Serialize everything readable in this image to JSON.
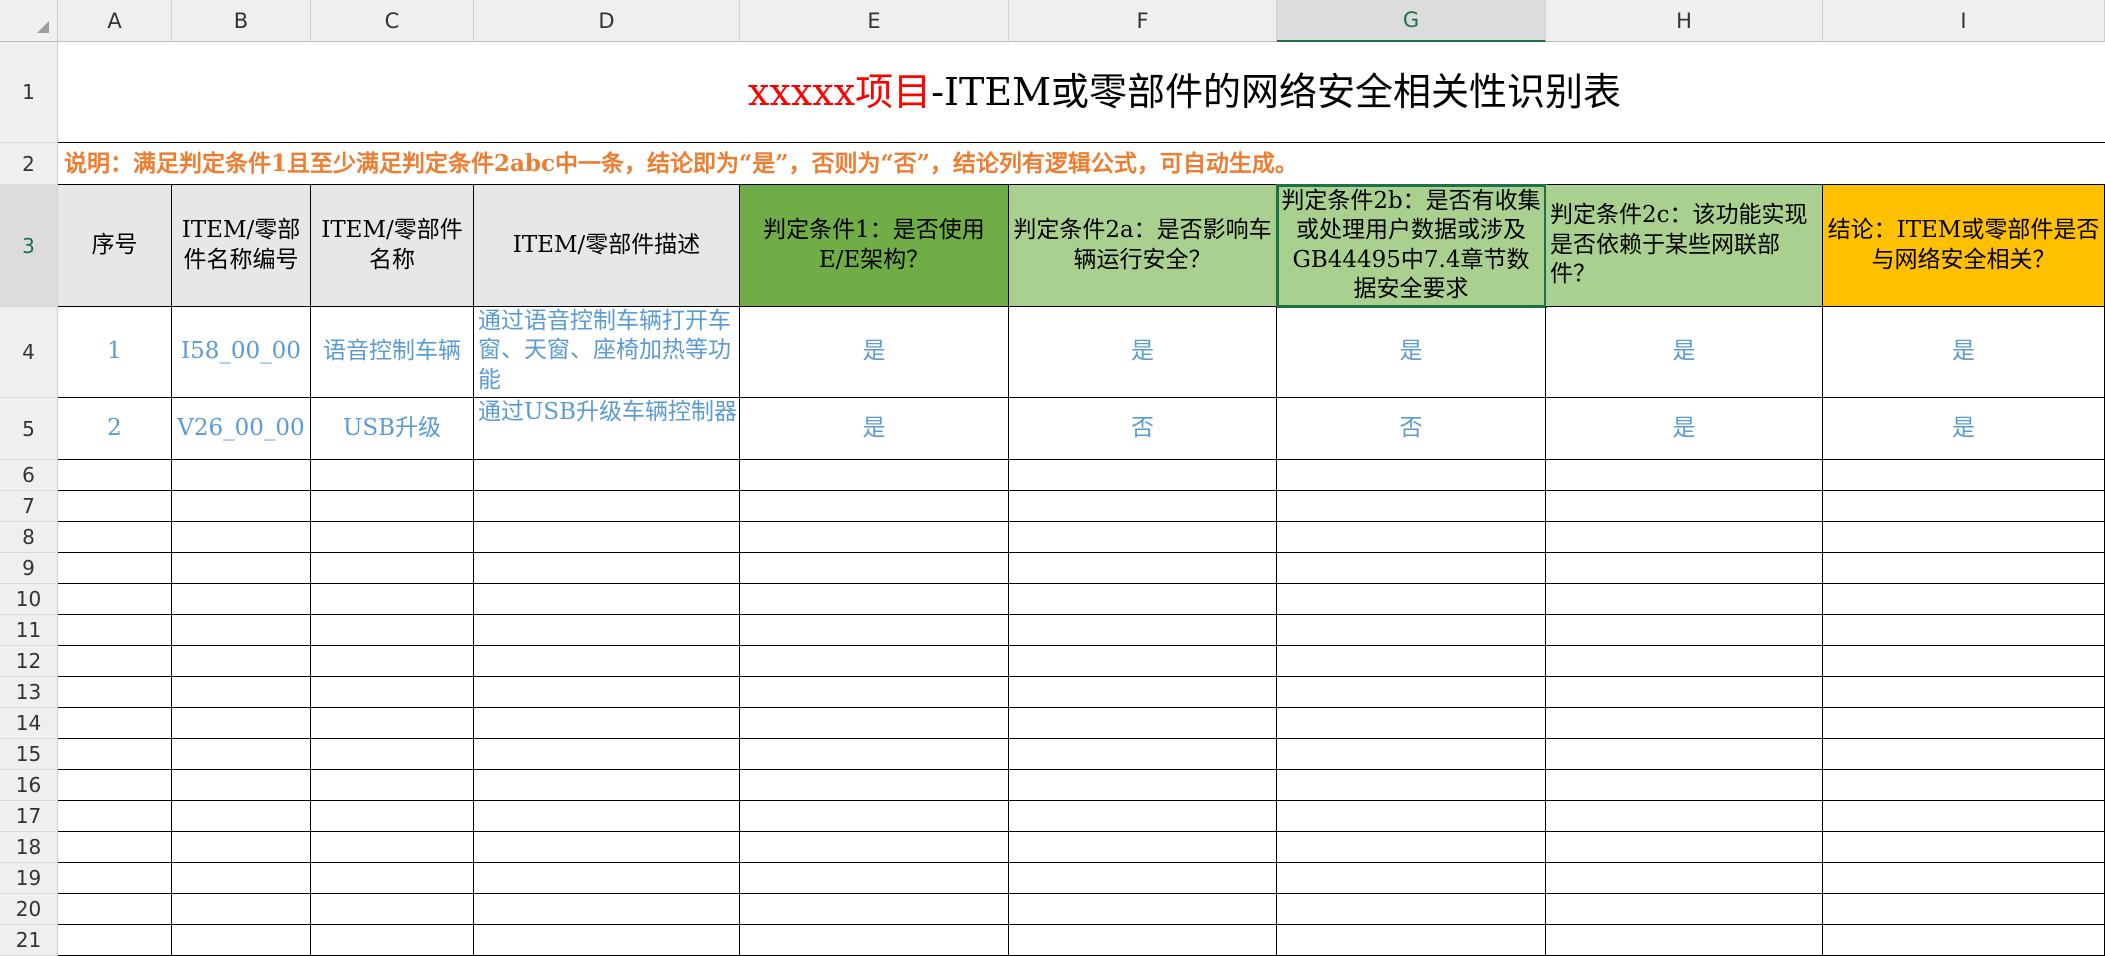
{
  "columns": [
    "A",
    "B",
    "C",
    "D",
    "E",
    "F",
    "G",
    "H",
    "I"
  ],
  "row_numbers": [
    "1",
    "2",
    "3",
    "4",
    "5",
    "6",
    "7",
    "8",
    "9",
    "10",
    "11",
    "12",
    "13",
    "14",
    "15",
    "16",
    "17",
    "18",
    "19",
    "20",
    "21"
  ],
  "title": {
    "red_part": "xxxxx项目",
    "black_part": "-ITEM或零部件的网络安全相关性识别表"
  },
  "note": "说明：满足判定条件1且至少满足判定条件2abc中一条，结论即为“是”，否则为“否”，结论列有逻辑公式，可自动生成。",
  "headers": [
    "序号",
    "ITEM/零部件名称编号",
    "ITEM/零部件名称",
    "ITEM/零部件描述",
    "判定条件1：是否使用E/E架构？",
    "判定条件2a：是否影响车辆运行安全？",
    "判定条件2b：是否有收集或处理用户数据或涉及GB44495中7.4章节数据安全要求",
    "判定条件2c：该功能实现是否依赖于某些网联部件？",
    "结论：ITEM或零部件是否与网络安全相关？"
  ],
  "rows": [
    [
      "1",
      "I58_00_00",
      "语音控制车辆",
      "通过语音控制车辆打开车窗、天窗、座椅加热等功能",
      "是",
      "是",
      "是",
      "是",
      "是"
    ],
    [
      "2",
      "V26_00_00",
      "USB升级",
      "通过USB升级车辆控制器",
      "是",
      "否",
      "否",
      "是",
      "是"
    ]
  ],
  "colors": {
    "dark_green": "#70ad47",
    "light_green": "#a9d08e",
    "orange": "#ffc000",
    "note_orange": "#ed7d31",
    "data_blue": "#5b9bd5",
    "title_red": "#ff0000"
  }
}
